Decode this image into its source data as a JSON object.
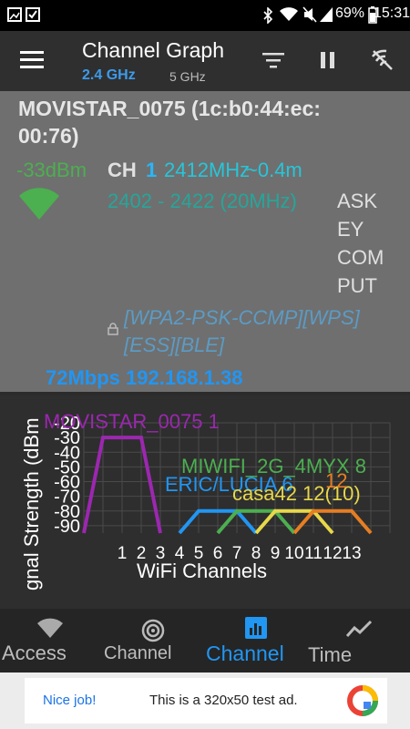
{
  "status": {
    "battery": "69%",
    "time": "15:31"
  },
  "appbar": {
    "title": "Channel Graph",
    "tab_24": "2.4 GHz",
    "tab_5": "5 GHz"
  },
  "detail": {
    "ssid_line1": "MOVISTAR_0075 (1c:b0:44:ec:",
    "ssid_line2": "00:76)",
    "level": "-33dBm",
    "ch_label": "CH",
    "ch_num": "1",
    "freq": "2412MHz",
    "distance": "~0.4m",
    "range": "2402 - 2422 (20MHz)",
    "vendor": [
      "ASK",
      "EY",
      "COM",
      "PUT"
    ],
    "security_1": "[WPA2-PSK-CCMP][WPS]",
    "security_2": "[ESS][BLE]",
    "speed_ip": "72Mbps 192.168.1.38"
  },
  "chart_data": {
    "type": "area",
    "ylabel": "gnal Strength (dBm",
    "xlabel": "WiFi Channels",
    "y_ticks": [
      "-20",
      "-30",
      "-40",
      "-50",
      "-60",
      "-70",
      "-80",
      "-90"
    ],
    "x_ticks": [
      "1",
      "2",
      "3",
      "4",
      "5",
      "6",
      "7",
      "8",
      "9",
      "10",
      "11",
      "12",
      "13"
    ],
    "series": [
      {
        "name": "MOVISTAR_0075 1",
        "channel": 1,
        "level": -30,
        "color": "#9c27b0"
      },
      {
        "name": "ERIC/LUCIA 6",
        "channel": 6,
        "level": -80,
        "color": "#2196f3"
      },
      {
        "name": "MIWIFI_2G_4MYX 8",
        "channel": 8,
        "level": -80,
        "color": "#4caf50"
      },
      {
        "name": "casa42 12(10)",
        "channel": 10,
        "level": -80,
        "color": "#e8d84a"
      },
      {
        "name": "12",
        "channel": 12,
        "level": -80,
        "color": "#e67e22"
      }
    ]
  },
  "nav": {
    "access": "Access",
    "channel_rating": "Channel",
    "channel_graph": "Channel",
    "time": "Time"
  },
  "ad": {
    "nice": "Nice job!",
    "text": "This is a 320x50 test ad."
  }
}
